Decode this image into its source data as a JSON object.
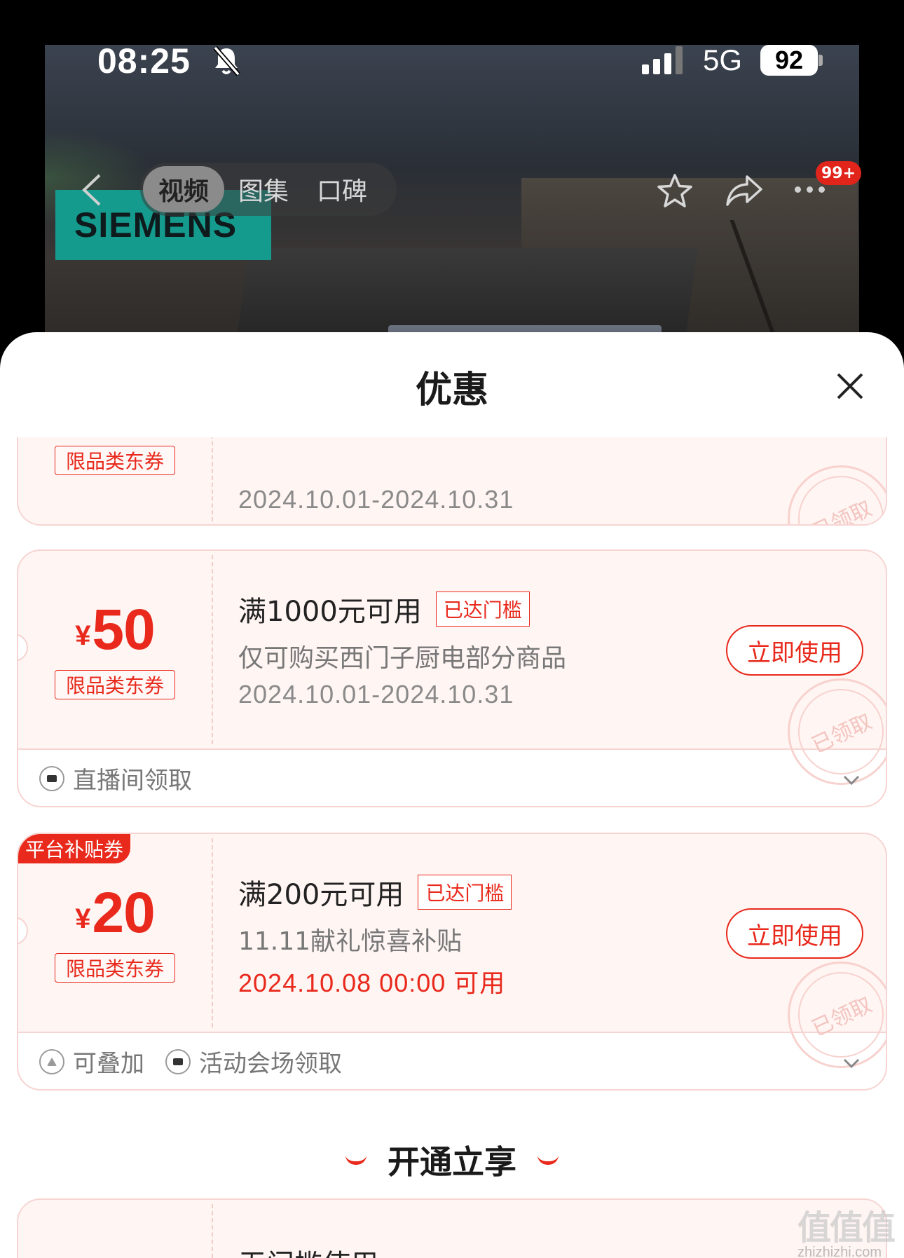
{
  "status_bar": {
    "time": "08:25",
    "network": "5G",
    "battery": "92"
  },
  "media": {
    "brand_logo": "SIEMENS",
    "tabs": [
      "视频",
      "图集",
      "口碑"
    ],
    "active_tab": 0,
    "more_badge": "99+"
  },
  "sheet": {
    "title": "优惠",
    "coupons": [
      {
        "category_tag": "限品类东券",
        "date": "2024.10.01-2024.10.31",
        "stamp": "已领取"
      },
      {
        "currency": "¥",
        "amount": "50",
        "category_tag": "限品类东券",
        "condition": "满1000元可用",
        "reached": "已达门槛",
        "description": "仅可购买西门子厨电部分商品",
        "date": "2024.10.01-2024.10.31",
        "button": "立即使用",
        "stamp": "已领取",
        "footer": [
          "直播间领取"
        ]
      },
      {
        "corner_label": "平台补贴券",
        "currency": "¥",
        "amount": "20",
        "category_tag": "限品类东券",
        "condition": "满200元可用",
        "reached": "已达门槛",
        "description": "11.11献礼惊喜补贴",
        "date": "2024.10.08 00:00 可用",
        "button": "立即使用",
        "stamp": "已领取",
        "footer": [
          "可叠加",
          "活动会场领取"
        ]
      }
    ],
    "section_title": "开通立享",
    "partial_coupon": {
      "condition": "无门槛使用"
    }
  },
  "watermark": {
    "big": "值值值",
    "small": "zhizhizhi.com"
  },
  "colors": {
    "accent": "#e8291c",
    "coupon_bg": "#fff5f3",
    "siemens_teal": "#159b8e"
  }
}
